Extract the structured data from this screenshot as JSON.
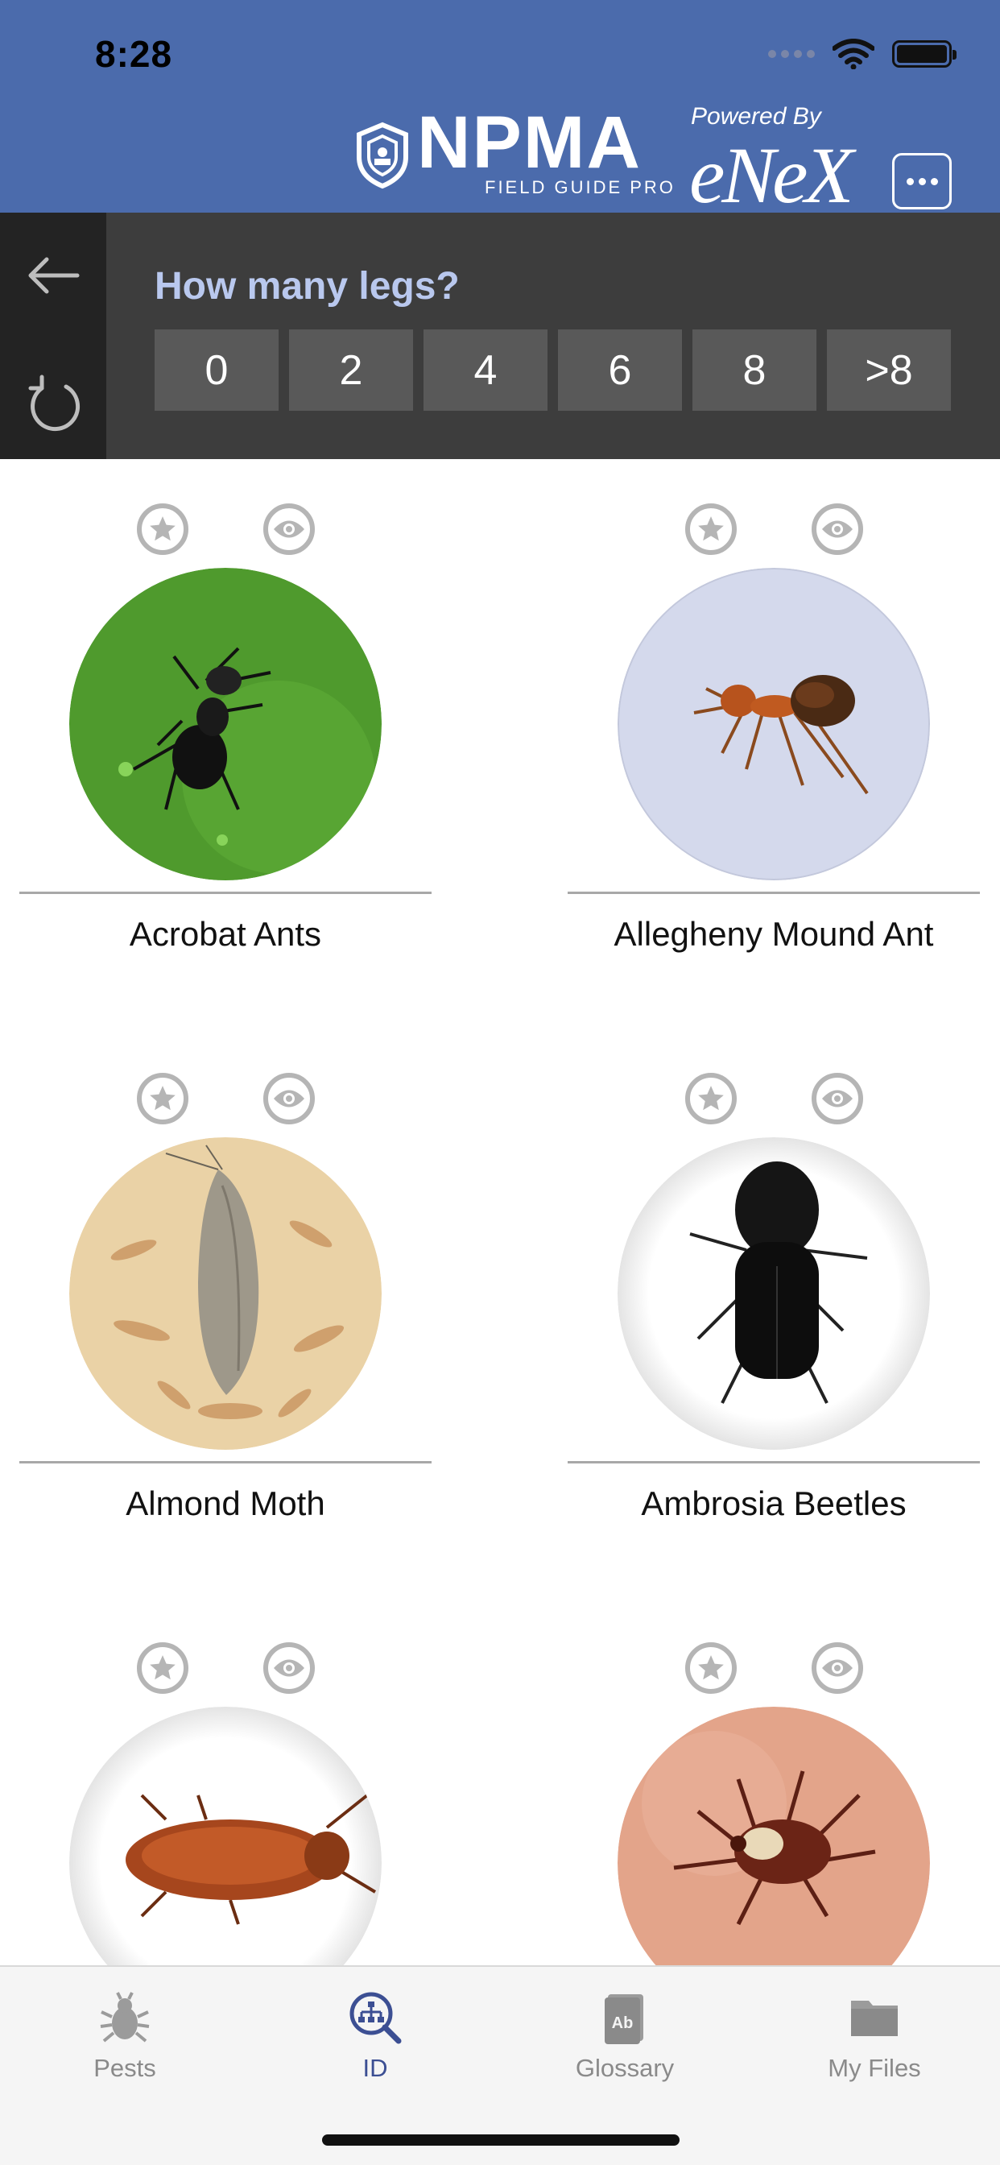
{
  "status_bar": {
    "time": "8:28"
  },
  "header": {
    "logo_main": "NPMA",
    "logo_sub": "FIELD GUIDE PRO",
    "powered_by": "Powered By",
    "brand": "eNeX"
  },
  "filter": {
    "question": "How many legs?",
    "options": [
      "0",
      "2",
      "4",
      "6",
      "8",
      ">8"
    ]
  },
  "pests": [
    {
      "name": "Acrobat Ants"
    },
    {
      "name": "Allegheny Mound Ant"
    },
    {
      "name": "Almond Moth"
    },
    {
      "name": "Ambrosia Beetles"
    },
    {
      "name": ""
    },
    {
      "name": ""
    }
  ],
  "tabs": [
    {
      "label": "Pests",
      "icon": "bug-icon"
    },
    {
      "label": "ID",
      "icon": "id-search-icon"
    },
    {
      "label": "Glossary",
      "icon": "book-icon"
    },
    {
      "label": "My Files",
      "icon": "folder-icon"
    }
  ],
  "colors": {
    "header_bg": "#4b6bac",
    "question_bar_bg": "#3d3d3d",
    "question_text": "#b9c8ee",
    "active_tab": "#3c4f93"
  }
}
